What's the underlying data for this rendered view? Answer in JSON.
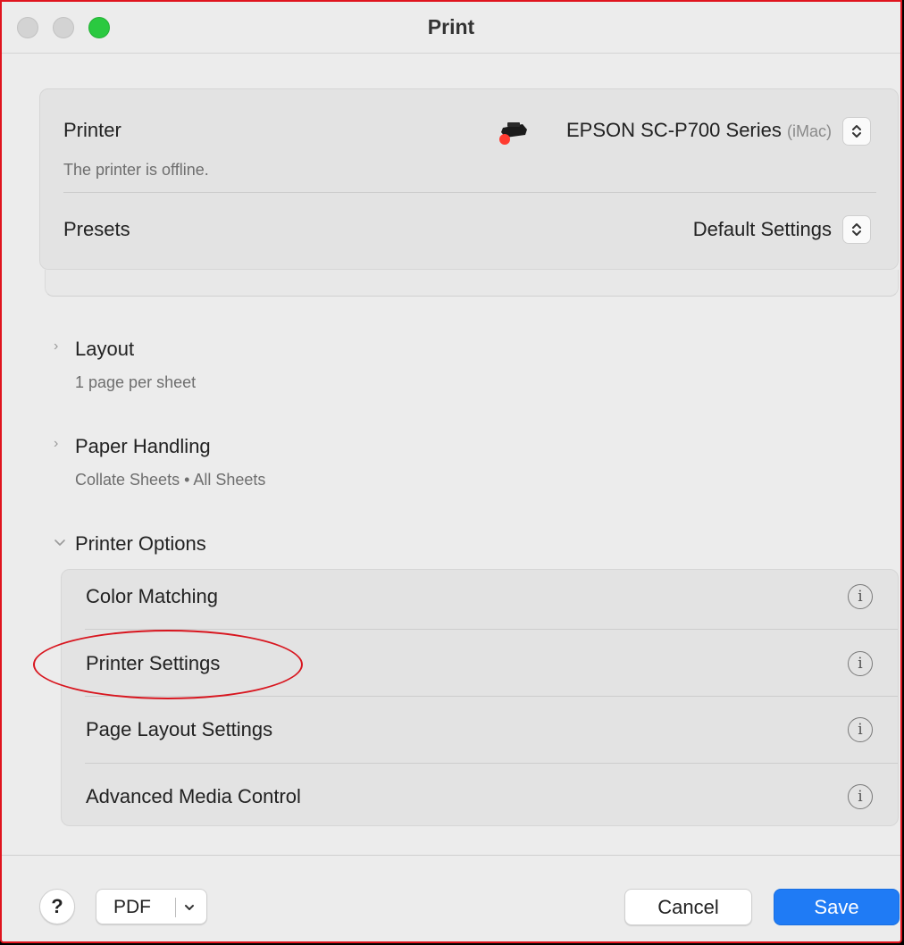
{
  "window": {
    "title": "Print",
    "frame_color": "#e0141e"
  },
  "printer_section": {
    "printer_label": "Printer",
    "printer_value": "EPSON SC-P700 Series",
    "printer_location": "(iMac)",
    "status_text": "The printer is offline.",
    "status_dot_color": "#ff3b30",
    "presets_label": "Presets",
    "presets_value": "Default Settings"
  },
  "sections": {
    "layout": {
      "title": "Layout",
      "summary": "1 page per sheet",
      "expanded": false
    },
    "paper_handling": {
      "title": "Paper Handling",
      "summary": "Collate Sheets • All Sheets",
      "expanded": false
    },
    "printer_options": {
      "title": "Printer Options",
      "expanded": true
    }
  },
  "printer_options_items": [
    {
      "label": "Color Matching",
      "icon": "info-icon"
    },
    {
      "label": "Printer Settings",
      "icon": "info-icon"
    },
    {
      "label": "Page Layout Settings",
      "icon": "info-icon"
    },
    {
      "label": "Advanced Media Control",
      "icon": "info-icon"
    }
  ],
  "annotation": {
    "target": "Printer Settings",
    "color": "#d8161f"
  },
  "footer": {
    "help_label": "?",
    "pdf_label": "PDF",
    "cancel_label": "Cancel",
    "save_label": "Save",
    "accent_color": "#1f7bf5"
  },
  "icons": {
    "info_glyph": "i",
    "chevron_right": "›",
    "chevron_down": "⌄"
  }
}
